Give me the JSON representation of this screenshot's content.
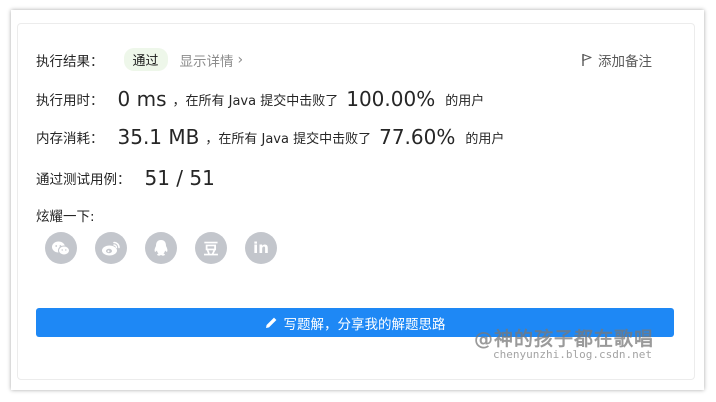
{
  "result": {
    "label": "执行结果：",
    "badge": "通过",
    "details_link": "显示详情",
    "chevron": "›"
  },
  "note_button": {
    "label": "添加备注",
    "icon": "flag-icon"
  },
  "runtime": {
    "label": "执行用时：",
    "value": "0 ms",
    "mid": "，在所有 Java 提交中击败了",
    "percent": "100.00%",
    "suffix": "的用户"
  },
  "memory": {
    "label": "内存消耗：",
    "value": "35.1 MB",
    "mid": "，在所有 Java 提交中击败了",
    "percent": "77.60%",
    "suffix": "的用户"
  },
  "testcases": {
    "label": "通过测试用例：",
    "value": "51 / 51"
  },
  "share": {
    "label": "炫耀一下:",
    "icons": [
      "wechat-icon",
      "weibo-icon",
      "qq-icon",
      "douban-icon",
      "linkedin-icon"
    ],
    "douban_glyph": "豆",
    "linkedin_glyph": "in"
  },
  "write_solution": {
    "label": "写题解，分享我的解题思路",
    "icon": "pencil-icon"
  },
  "watermark": {
    "line1": "@神的孩子都在歌唱",
    "line2": "chenyunzhi.blog.csdn.net"
  },
  "colors": {
    "primary": "#1e88f5",
    "badge_bg": "#eef7ea",
    "icon_gray": "#c3c6cc"
  }
}
